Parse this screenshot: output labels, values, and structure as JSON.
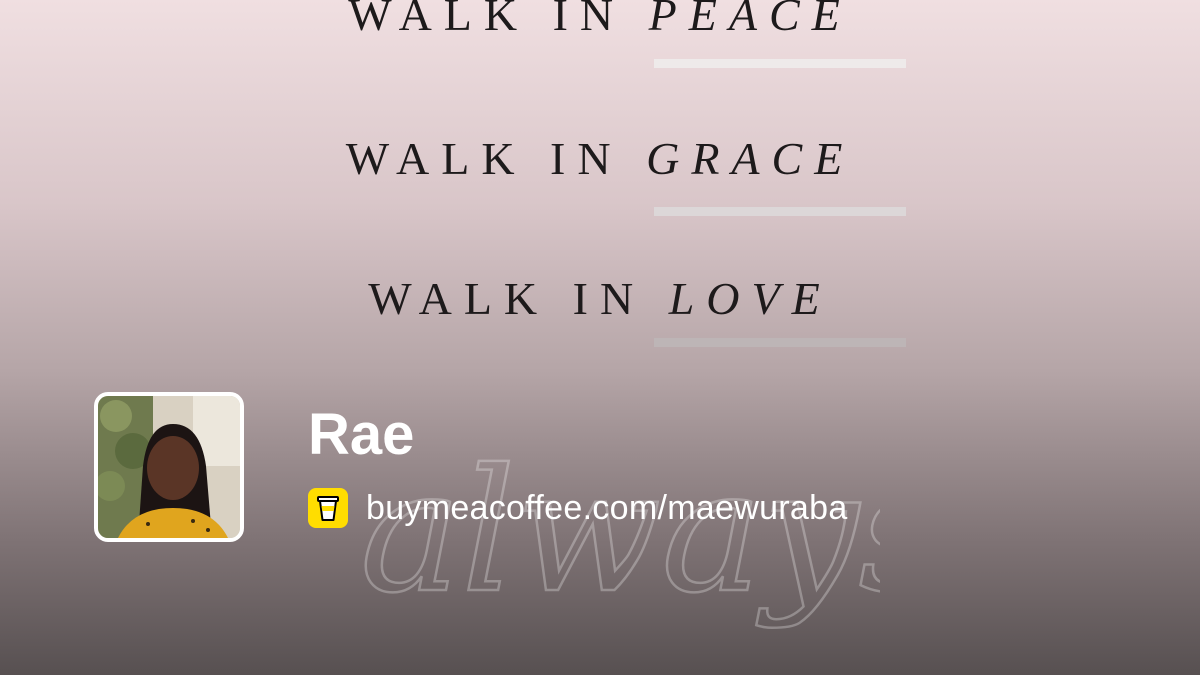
{
  "cover": {
    "lines": [
      {
        "prefix": "WALK IN",
        "emphasis": "PEACE"
      },
      {
        "prefix": "WALK IN",
        "emphasis": "GRACE"
      },
      {
        "prefix": "WALK IN",
        "emphasis": "LOVE"
      }
    ],
    "script_word": "always"
  },
  "profile": {
    "name": "Rae",
    "url": "buymeacoffee.com/maewuraba"
  },
  "colors": {
    "brand_yellow": "#ffdd00",
    "text_white": "#ffffff",
    "quote_text": "#1d1a1b"
  },
  "icons": {
    "brand": "coffee-cup-icon"
  }
}
